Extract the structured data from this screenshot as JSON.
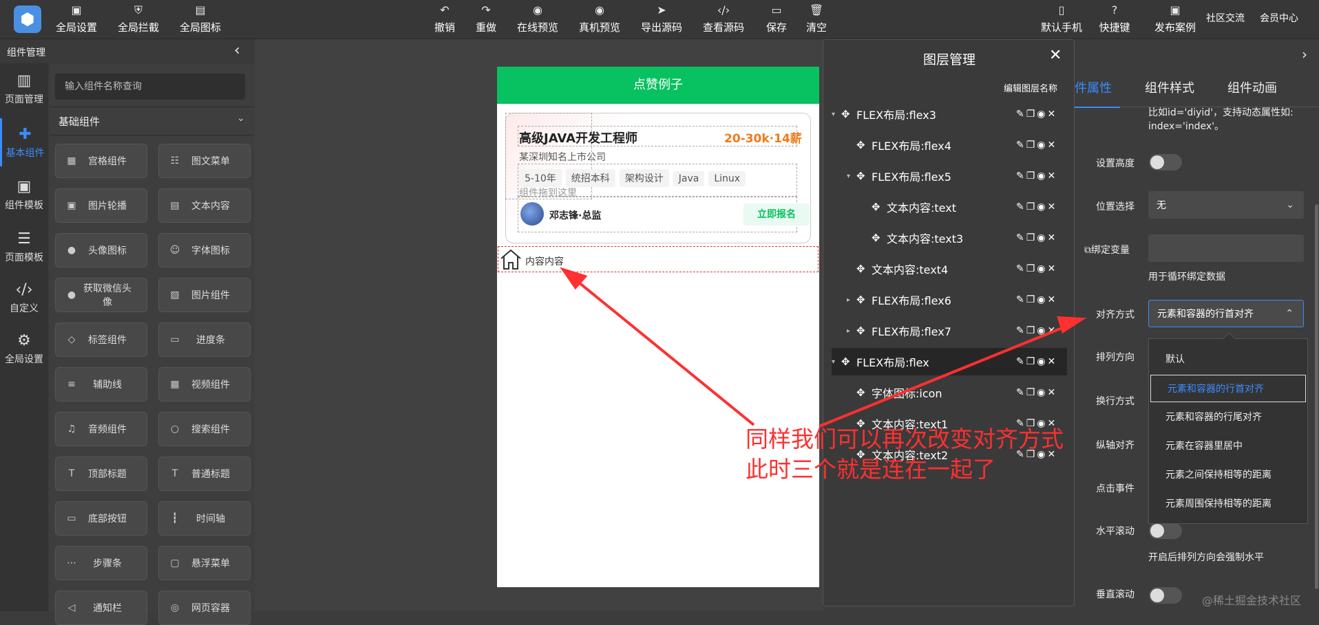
{
  "toolbar": {
    "left": [
      "全局设置",
      "全局拦截",
      "全局图标"
    ],
    "center": [
      "撤销",
      "重做",
      "在线预览",
      "真机预览",
      "导出源码",
      "查看源码",
      "保存",
      "清空"
    ],
    "right": [
      "默认手机",
      "快捷键",
      "发布案例",
      "社区交流",
      "会员中心"
    ]
  },
  "left_nav": [
    "页面管理",
    "基本组件",
    "组件模板",
    "页面模板",
    "自定义",
    "全局设置"
  ],
  "component_panel": {
    "title": "组件管理",
    "search_placeholder": "输入组件名称查询",
    "section": "基础组件",
    "items": [
      "宫格组件",
      "图文菜单",
      "图片轮播",
      "文本内容",
      "头像图标",
      "字体图标",
      "获取微信头像",
      "图片组件",
      "标签组件",
      "进度条",
      "辅助线",
      "视频组件",
      "音频组件",
      "搜索组件",
      "顶部标题",
      "普通标题",
      "底部按钮",
      "时间轴",
      "步骤条",
      "悬浮菜单",
      "通知栏",
      "网页容器"
    ]
  },
  "phone": {
    "title": "点赞例子",
    "job_title": "高级JAVA开发工程师",
    "salary": "20-30k·14薪",
    "company": "某深圳知名上市公司",
    "tags": [
      "5-10年",
      "统招本科",
      "架构设计",
      "Java",
      "Linux"
    ],
    "drop_hint": "组件拖到这里",
    "person": "邓志锋·总监",
    "apply": "立即报名",
    "content_text": "内容内容"
  },
  "layer_panel": {
    "title": "图层管理",
    "edit_label": "编辑图层名称",
    "rows": [
      {
        "name": "FLEX布局:flex3",
        "arrow": "▾"
      },
      {
        "name": "FLEX布局:flex4",
        "arrow": ""
      },
      {
        "name": "FLEX布局:flex5",
        "arrow": "▾"
      },
      {
        "name": "文本内容:text",
        "arrow": ""
      },
      {
        "name": "文本内容:text3",
        "arrow": ""
      },
      {
        "name": "文本内容:text4",
        "arrow": ""
      },
      {
        "name": "FLEX布局:flex6",
        "arrow": "▸"
      },
      {
        "name": "FLEX布局:flex7",
        "arrow": "▸"
      },
      {
        "name": "FLEX布局:flex",
        "arrow": "▾"
      },
      {
        "name": "字体图标:icon",
        "arrow": ""
      },
      {
        "name": "文本内容:text1",
        "arrow": ""
      },
      {
        "name": "文本内容:text2",
        "arrow": ""
      }
    ]
  },
  "right_panel": {
    "tabs": [
      "件属性",
      "组件样式",
      "组件动画"
    ],
    "hint_line1": "比如id='diyid'，支持动态属性如:",
    "hint_line2": "index='index'。",
    "set_height": "设置高度",
    "position_label": "位置选择",
    "position_value": "无",
    "bind_label": "绑定变量",
    "bind_hint": "用于循环绑定数据",
    "align_label": "对齐方式",
    "align_value": "元素和容器的行首对齐",
    "direction_label": "排列方向",
    "wrap_label": "换行方式",
    "vertical_label": "纵轴对齐",
    "click_label": "点击事件",
    "hscroll_label": "水平滚动",
    "hscroll_hint": "开启后排列方向会强制水平",
    "vscroll_label": "垂直滚动",
    "dropdown": [
      "默认",
      "元素和容器的行首对齐",
      "元素和容器的行尾对齐",
      "元素在容器里居中",
      "元素之间保持相等的距离",
      "元素周围保持相等的距离"
    ]
  },
  "annotation": {
    "line1": "同样我们可以再次改变对齐方式",
    "line2": "此时三个就是连在一起了"
  },
  "watermark": "@稀土掘金技术社区",
  "colors": {
    "accent": "#3b8cff",
    "brand_green": "#08c160",
    "annotation": "#ff3030",
    "salary": "#f07a18"
  }
}
